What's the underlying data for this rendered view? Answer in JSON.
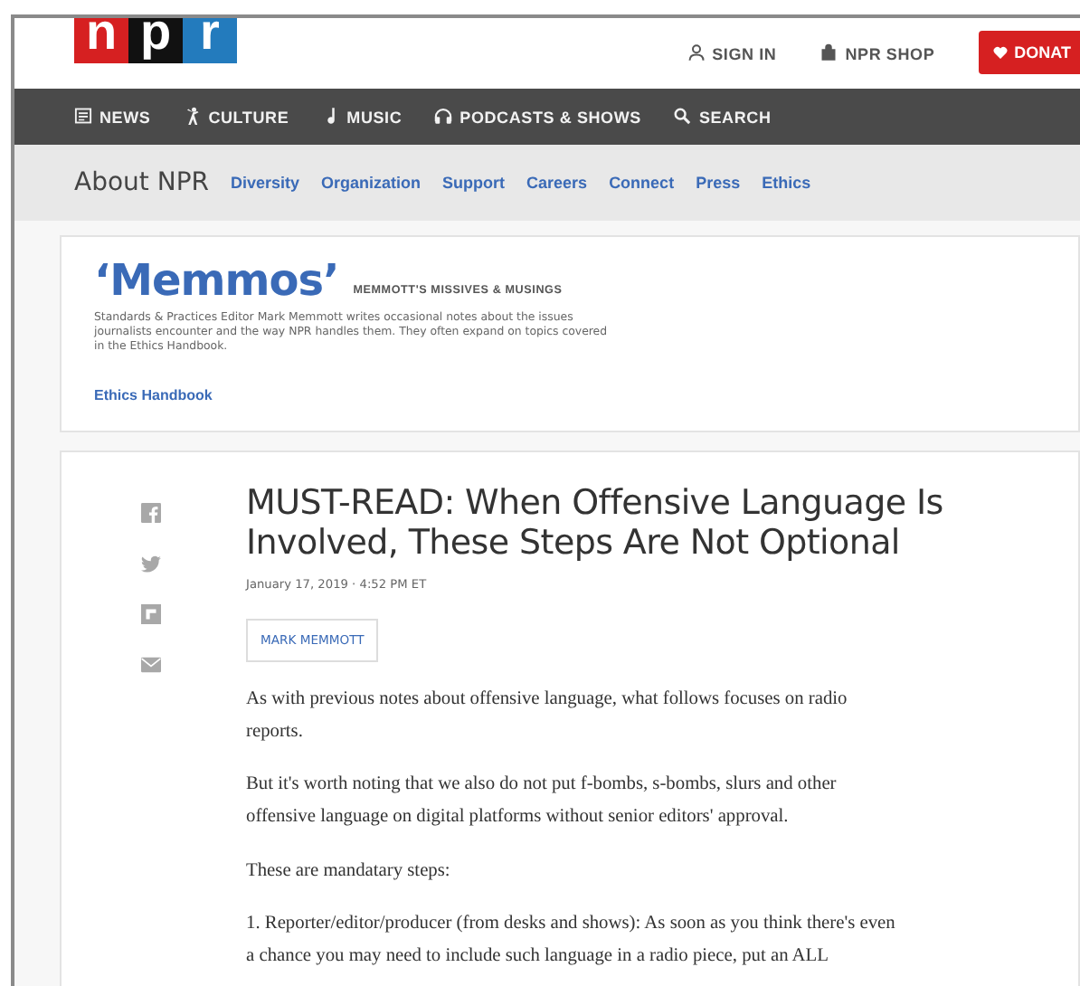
{
  "header": {
    "logo_letters": [
      "n",
      "p",
      "r"
    ],
    "utility_links": [
      {
        "kind": "user",
        "label": "SIGN IN"
      },
      {
        "kind": "bag",
        "label": "NPR SHOP"
      }
    ],
    "donate": "DONAT"
  },
  "main_nav": [
    {
      "kind": "news",
      "label": "NEWS"
    },
    {
      "kind": "culture",
      "label": "CULTURE"
    },
    {
      "kind": "music",
      "label": "MUSIC"
    },
    {
      "kind": "headphones",
      "label": "PODCASTS & SHOWS"
    },
    {
      "kind": "search",
      "label": "SEARCH"
    }
  ],
  "sub_nav": {
    "title": "About NPR",
    "links": [
      "Diversity",
      "Organization",
      "Support",
      "Careers",
      "Connect",
      "Press",
      "Ethics"
    ]
  },
  "blog_card": {
    "title": "‘Memmos’",
    "tagline": "MEMMOTT'S MISSIVES & MUSINGS",
    "description": "Standards & Practices Editor Mark Memmott writes occasional notes about the issues journalists encounter and the way NPR handles them. They often expand on topics covered in the Ethics Handbook.",
    "link": "Ethics Handbook"
  },
  "article": {
    "share_icons": [
      {
        "kind": "facebook"
      },
      {
        "kind": "twitter"
      },
      {
        "kind": "flipboard"
      },
      {
        "kind": "email"
      }
    ],
    "title": "MUST-READ: When Offensive Language Is Involved, These Steps Are Not Optional",
    "date": "January 17, 2019 · 4:52 PM ET",
    "author": "MARK MEMMOTT",
    "paragraphs": [
      "As with previous notes about offensive language, what follows focuses on radio reports.",
      "But it's worth noting that we also do not put f-bombs, s-bombs, slurs and other offensive language on digital platforms without senior editors' approval.",
      "These are mandatary steps:",
      "1. Reporter/editor/producer (from desks and shows): As soon as you think there's even a chance you may need to include such language in a radio piece, put an ALL"
    ]
  }
}
